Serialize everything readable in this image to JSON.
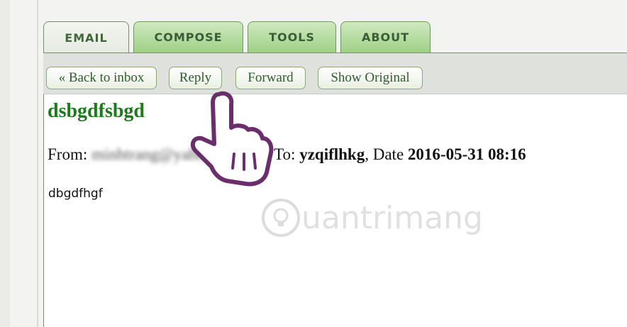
{
  "tabs": [
    {
      "label": "EMAIL",
      "active": true
    },
    {
      "label": "COMPOSE",
      "active": false
    },
    {
      "label": "TOOLS",
      "active": false
    },
    {
      "label": "ABOUT",
      "active": false
    }
  ],
  "toolbar": {
    "back_label": "« Back to inbox",
    "reply_label": "Reply",
    "forward_label": "Forward",
    "show_original_label": "Show Original"
  },
  "message": {
    "subject": "dsbgdfsbgd",
    "from_label": "From:",
    "from_value": "minhtrang@yahoo.com.vn,",
    "to_label": "To:",
    "to_value": "yzqiflhkg",
    "date_label": ", Date",
    "date_value": "2016-05-31 08:16",
    "body": "dbgdfhgf"
  },
  "watermark": {
    "text": "uantrimang"
  },
  "colors": {
    "accent": "#1f7a1f",
    "tab_green": "#9fd086"
  }
}
